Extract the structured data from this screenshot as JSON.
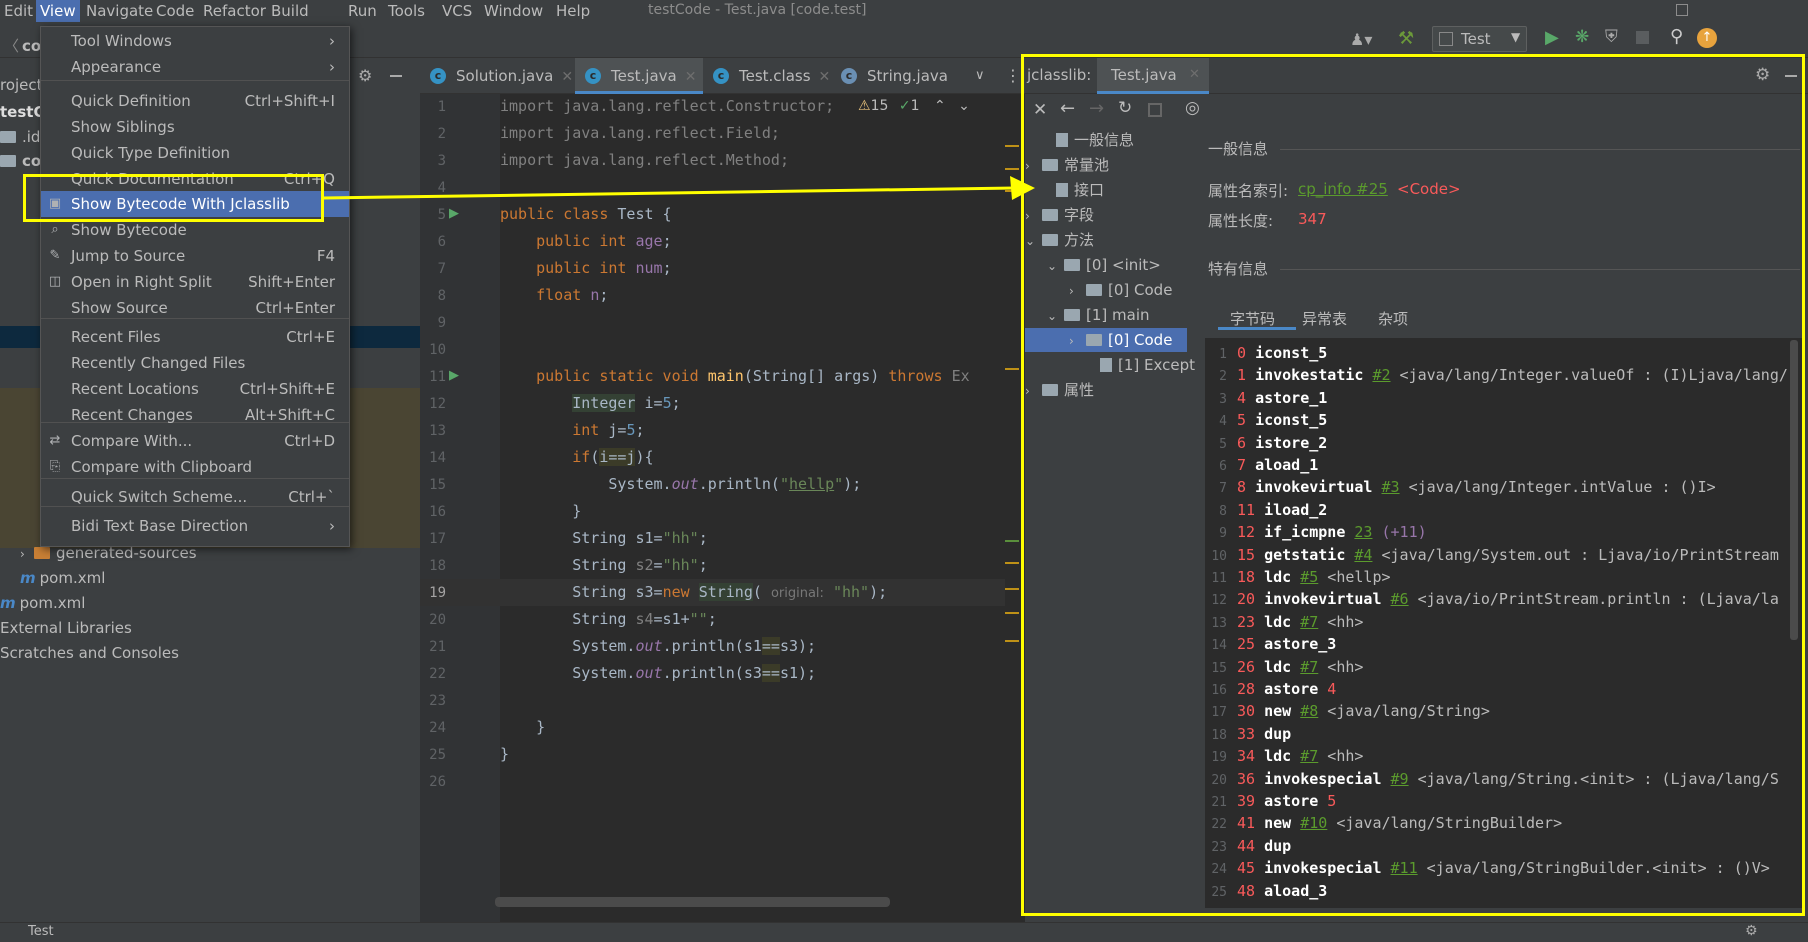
{
  "menubar": {
    "items": [
      "Edit",
      "View",
      "Navigate",
      "Code",
      "Refactor",
      "Build",
      "Run",
      "Tools",
      "VCS",
      "Window",
      "Help"
    ],
    "window_title": "testCode - Test.java [code.test]"
  },
  "toolbar": {
    "run_config": "Test"
  },
  "view_menu": {
    "items": [
      {
        "label": "Tool Windows",
        "shortcut": ""
      },
      {
        "label": "Appearance",
        "shortcut": ""
      },
      {
        "label": "Quick Definition",
        "shortcut": "Ctrl+Shift+I"
      },
      {
        "label": "Show Siblings",
        "shortcut": ""
      },
      {
        "label": "Quick Type Definition",
        "shortcut": ""
      },
      {
        "label": "Quick Documentation",
        "shortcut": "Ctrl+Q"
      },
      {
        "label": "Show Bytecode With Jclasslib",
        "shortcut": ""
      },
      {
        "label": "Show Bytecode",
        "shortcut": ""
      },
      {
        "label": "Jump to Source",
        "shortcut": "F4"
      },
      {
        "label": "Open in Right Split",
        "shortcut": "Shift+Enter"
      },
      {
        "label": "Show Source",
        "shortcut": "Ctrl+Enter"
      },
      {
        "label": "Recent Files",
        "shortcut": "Ctrl+E"
      },
      {
        "label": "Recently Changed Files",
        "shortcut": ""
      },
      {
        "label": "Recent Locations",
        "shortcut": "Ctrl+Shift+E"
      },
      {
        "label": "Recent Changes",
        "shortcut": "Alt+Shift+C"
      },
      {
        "label": "Compare With...",
        "shortcut": "Ctrl+D"
      },
      {
        "label": "Compare with Clipboard",
        "shortcut": ""
      },
      {
        "label": "Quick Switch Scheme...",
        "shortcut": "Ctrl+`"
      },
      {
        "label": "Bidi Text Base Direction",
        "shortcut": ""
      }
    ]
  },
  "project": {
    "frag_co": "co",
    "frag_project": "roject",
    "frag_testc": "testC",
    "frag_id": ".id",
    "frag_co2": "co",
    "generated_sources": "generated-sources",
    "pom1": "pom.xml",
    "pom2": "pom.xml",
    "external_libraries": "External Libraries",
    "scratches": "Scratches and Consoles"
  },
  "editor": {
    "tabs": [
      "Solution.java",
      "Test.java",
      "Test.class",
      "String.java"
    ],
    "warnings": "15",
    "oks": "1",
    "line_numbers": [
      "1",
      "2",
      "3",
      "4",
      "5",
      "6",
      "7",
      "8",
      "9",
      "10",
      "11",
      "12",
      "13",
      "14",
      "15",
      "16",
      "17",
      "18",
      "19",
      "20",
      "21",
      "22",
      "23",
      "24",
      "25",
      "26"
    ],
    "inlay_hint": "original:"
  },
  "jclasslib": {
    "title": "jclasslib:",
    "tab": "Test.java",
    "tree": {
      "general": "一般信息",
      "constant_pool": "常量池",
      "interfaces": "接口",
      "fields": "字段",
      "methods": "方法",
      "init": "[0] <init>",
      "init_code": "[0] Code",
      "main": "[1] main",
      "main_code": "[0] Code",
      "main_except": "[1] Except",
      "attributes": "属性"
    },
    "general_header": "一般信息",
    "attr_name_index_label": "属性名索引:",
    "attr_name_index_link": "cp_info #25",
    "attr_name_index_value": "<Code>",
    "attr_length_label": "属性长度:",
    "attr_length_value": "347",
    "specific_header": "特有信息",
    "subtabs": [
      "字节码",
      "异常表",
      "杂项"
    ],
    "bytecode": [
      {
        "n": "1",
        "off": "0",
        "op": "iconst_5",
        "ref": "",
        "rest": ""
      },
      {
        "n": "2",
        "off": "1",
        "op": "invokestatic",
        "ref": "#2",
        "rest": " <java/lang/Integer.valueOf : (I)Ljava/lang/"
      },
      {
        "n": "3",
        "off": "4",
        "op": "astore_1",
        "ref": "",
        "rest": ""
      },
      {
        "n": "4",
        "off": "5",
        "op": "iconst_5",
        "ref": "",
        "rest": ""
      },
      {
        "n": "5",
        "off": "6",
        "op": "istore_2",
        "ref": "",
        "rest": ""
      },
      {
        "n": "6",
        "off": "7",
        "op": "aload_1",
        "ref": "",
        "rest": ""
      },
      {
        "n": "7",
        "off": "8",
        "op": "invokevirtual",
        "ref": "#3",
        "rest": " <java/lang/Integer.intValue : ()I>"
      },
      {
        "n": "8",
        "off": "11",
        "op": "iload_2",
        "ref": "",
        "rest": ""
      },
      {
        "n": "9",
        "off": "12",
        "op": "if_icmpne",
        "ref": "23",
        "rest": " (+11)"
      },
      {
        "n": "10",
        "off": "15",
        "op": "getstatic",
        "ref": "#4",
        "rest": " <java/lang/System.out : Ljava/io/PrintStream"
      },
      {
        "n": "11",
        "off": "18",
        "op": "ldc",
        "ref": "#5",
        "rest": " <hellp>"
      },
      {
        "n": "12",
        "off": "20",
        "op": "invokevirtual",
        "ref": "#6",
        "rest": " <java/io/PrintStream.println : (Ljava/la"
      },
      {
        "n": "13",
        "off": "23",
        "op": "ldc",
        "ref": "#7",
        "rest": " <hh>"
      },
      {
        "n": "14",
        "off": "25",
        "op": "astore_3",
        "ref": "",
        "rest": ""
      },
      {
        "n": "15",
        "off": "26",
        "op": "ldc",
        "ref": "#7",
        "rest": " <hh>"
      },
      {
        "n": "16",
        "off": "28",
        "op": "astore",
        "ref": "",
        "rest": " 4"
      },
      {
        "n": "17",
        "off": "30",
        "op": "new",
        "ref": "#8",
        "rest": " <java/lang/String>"
      },
      {
        "n": "18",
        "off": "33",
        "op": "dup",
        "ref": "",
        "rest": ""
      },
      {
        "n": "19",
        "off": "34",
        "op": "ldc",
        "ref": "#7",
        "rest": " <hh>"
      },
      {
        "n": "20",
        "off": "36",
        "op": "invokespecial",
        "ref": "#9",
        "rest": " <java/lang/String.<init> : (Ljava/lang/S"
      },
      {
        "n": "21",
        "off": "39",
        "op": "astore",
        "ref": "",
        "rest": " 5"
      },
      {
        "n": "22",
        "off": "41",
        "op": "new",
        "ref": "#10",
        "rest": " <java/lang/StringBuilder>"
      },
      {
        "n": "23",
        "off": "44",
        "op": "dup",
        "ref": "",
        "rest": ""
      },
      {
        "n": "24",
        "off": "45",
        "op": "invokespecial",
        "ref": "#11",
        "rest": " <java/lang/StringBuilder.<init> : ()V>"
      },
      {
        "n": "25",
        "off": "48",
        "op": "aload_3",
        "ref": "",
        "rest": ""
      }
    ]
  },
  "status": {
    "run_tab": "Test"
  },
  "colors": {
    "highlight": "#ffff00",
    "selection": "#4b6eaf"
  }
}
